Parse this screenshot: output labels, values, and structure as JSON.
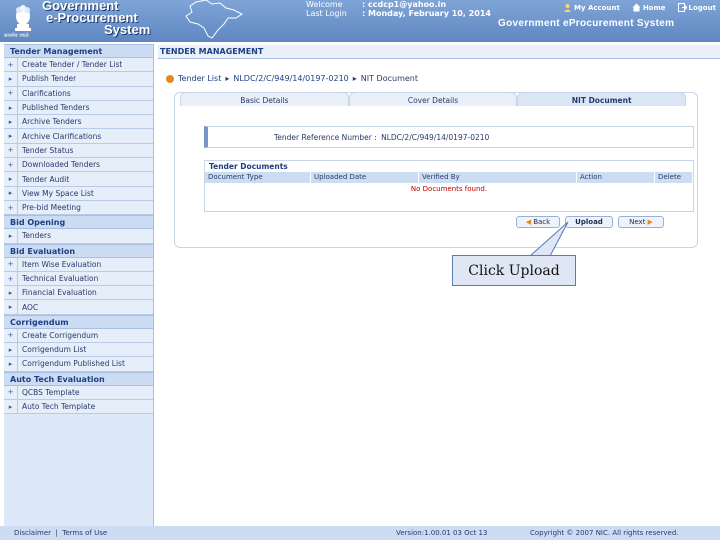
{
  "header": {
    "brand": [
      "Government",
      "e-Procurement",
      "System"
    ],
    "emblem_caption": "सत्यमेव जयते",
    "welcome_label": "Welcome",
    "welcome_value": "ccdcp1@yahoo.in",
    "last_login_label": "Last Login",
    "last_login_value": "Monday, February 10, 2014",
    "sep": ":",
    "links": {
      "my_account": "My Account",
      "home": "Home",
      "logout": "Logout"
    },
    "system_title": "Government eProcurement System"
  },
  "page_title": "TENDER MANAGEMENT",
  "sidebar": {
    "sections": [
      {
        "title": "Tender Management",
        "items": [
          {
            "label": "Create Tender / Tender List",
            "arrow": "+"
          },
          {
            "label": "Publish Tender",
            "arrow": "▸"
          },
          {
            "label": "Clarifications",
            "arrow": "+"
          },
          {
            "label": "Published Tenders",
            "arrow": "▸"
          },
          {
            "label": "Archive Tenders",
            "arrow": "▸"
          },
          {
            "label": "Archive Clarifications",
            "arrow": "▸"
          },
          {
            "label": "Tender Status",
            "arrow": "+"
          },
          {
            "label": "Downloaded Tenders",
            "arrow": "+"
          },
          {
            "label": "Tender Audit",
            "arrow": "▸"
          },
          {
            "label": "View My Space List",
            "arrow": "▸"
          },
          {
            "label": "Pre-bid Meeting",
            "arrow": "+"
          }
        ]
      },
      {
        "title": "Bid Opening",
        "items": [
          {
            "label": "Tenders",
            "arrow": "▸"
          }
        ]
      },
      {
        "title": "Bid Evaluation",
        "items": [
          {
            "label": "Item Wise Evaluation",
            "arrow": "+"
          },
          {
            "label": "Technical Evaluation",
            "arrow": "+"
          },
          {
            "label": "Financial Evaluation",
            "arrow": "▸"
          },
          {
            "label": "AOC",
            "arrow": "▸"
          }
        ]
      },
      {
        "title": "Corrigendum",
        "items": [
          {
            "label": "Create Corrigendum",
            "arrow": "+"
          },
          {
            "label": "Corrigendum List",
            "arrow": "▸"
          },
          {
            "label": "Corrigendum Published List",
            "arrow": "▸"
          }
        ]
      },
      {
        "title": "Auto Tech Evaluation",
        "items": [
          {
            "label": "QCBS Template",
            "arrow": "+"
          },
          {
            "label": "Auto Tech Template",
            "arrow": "▸"
          }
        ]
      }
    ]
  },
  "breadcrumb": {
    "root": "Tender List",
    "sep": "▸",
    "tender_id": "NLDC/2/C/949/14/0197-0210",
    "current": "NIT Document"
  },
  "tabs": [
    {
      "label": "Basic Details",
      "active": false
    },
    {
      "label": "Cover Details",
      "active": false
    },
    {
      "label": "NIT Document",
      "active": true
    }
  ],
  "reference": {
    "label": "Tender Reference Number :",
    "value": "NLDC/2/C/949/14/0197-0210"
  },
  "documents": {
    "title": "Tender Documents",
    "columns": [
      "Document Type",
      "Uploaded Date",
      "Verified By",
      "Action",
      "Delete"
    ],
    "empty_message": "No Documents found."
  },
  "buttons": {
    "back": "Back",
    "upload": "Upload",
    "next": "Next"
  },
  "callout": "Click Upload",
  "footer": {
    "disclaimer": "Disclaimer",
    "divider": "|",
    "terms": "Terms of Use",
    "version": "Version:1.00.01 03 Oct 13",
    "copyright": "Copyright © 2007 NIC. All rights reserved."
  },
  "colors": {
    "header_bg": "#6e96cc",
    "accent_orange": "#e58a1f",
    "sidebar_bg": "#dde9f8",
    "error_red": "#c00000"
  }
}
